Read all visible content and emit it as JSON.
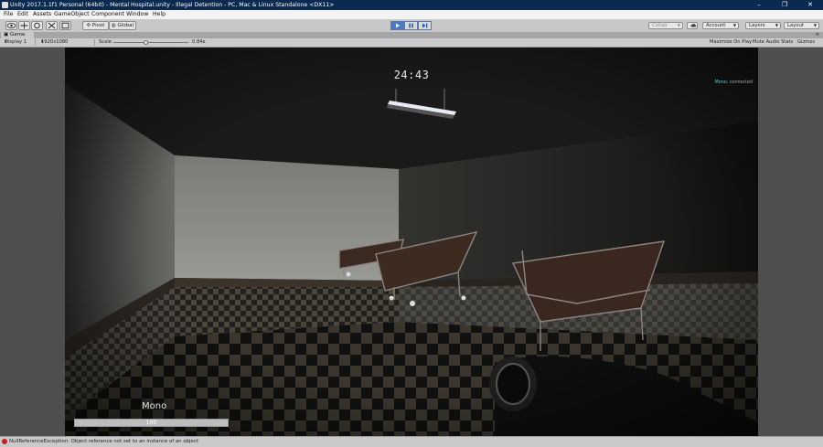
{
  "window": {
    "title": "Unity 2017.1.1f1 Personal (64bit) - Mental Hospital.unity - Illegal Detention - PC, Mac & Linux Standalone <DX11>",
    "controls": [
      "–",
      "❐",
      "✕"
    ]
  },
  "menu": [
    "File",
    "Edit",
    "Assets",
    "GameObject",
    "Component",
    "Window",
    "Help"
  ],
  "toolbar": {
    "pivot": "Pivot",
    "global": "Global",
    "collab": "Collab",
    "account": "Account",
    "layers": "Layers",
    "layout": "Layout",
    "colors": {
      "play_active": "#4a78c2",
      "play_icon": "#1f57b8"
    }
  },
  "game_view": {
    "tab_label": "Game",
    "display": "Display 1",
    "resolution": "1920x1080",
    "scale_label": "Scale",
    "scale_value": "0.84x",
    "scale_fraction": 0.4,
    "toggles": [
      "Maximize On Play",
      "Mute Audio",
      "Stats",
      "Gizmos"
    ]
  },
  "hud": {
    "timer": "24:43",
    "weapon_name": "Mono",
    "ammo_value": "100",
    "ammo_fraction": 1.0,
    "net_key": "Mono",
    "net_value": ": connected"
  },
  "status_bar": {
    "message": "NullReferenceException: Object reference not set to an instance of an object",
    "error_color": "#c81e1e"
  }
}
